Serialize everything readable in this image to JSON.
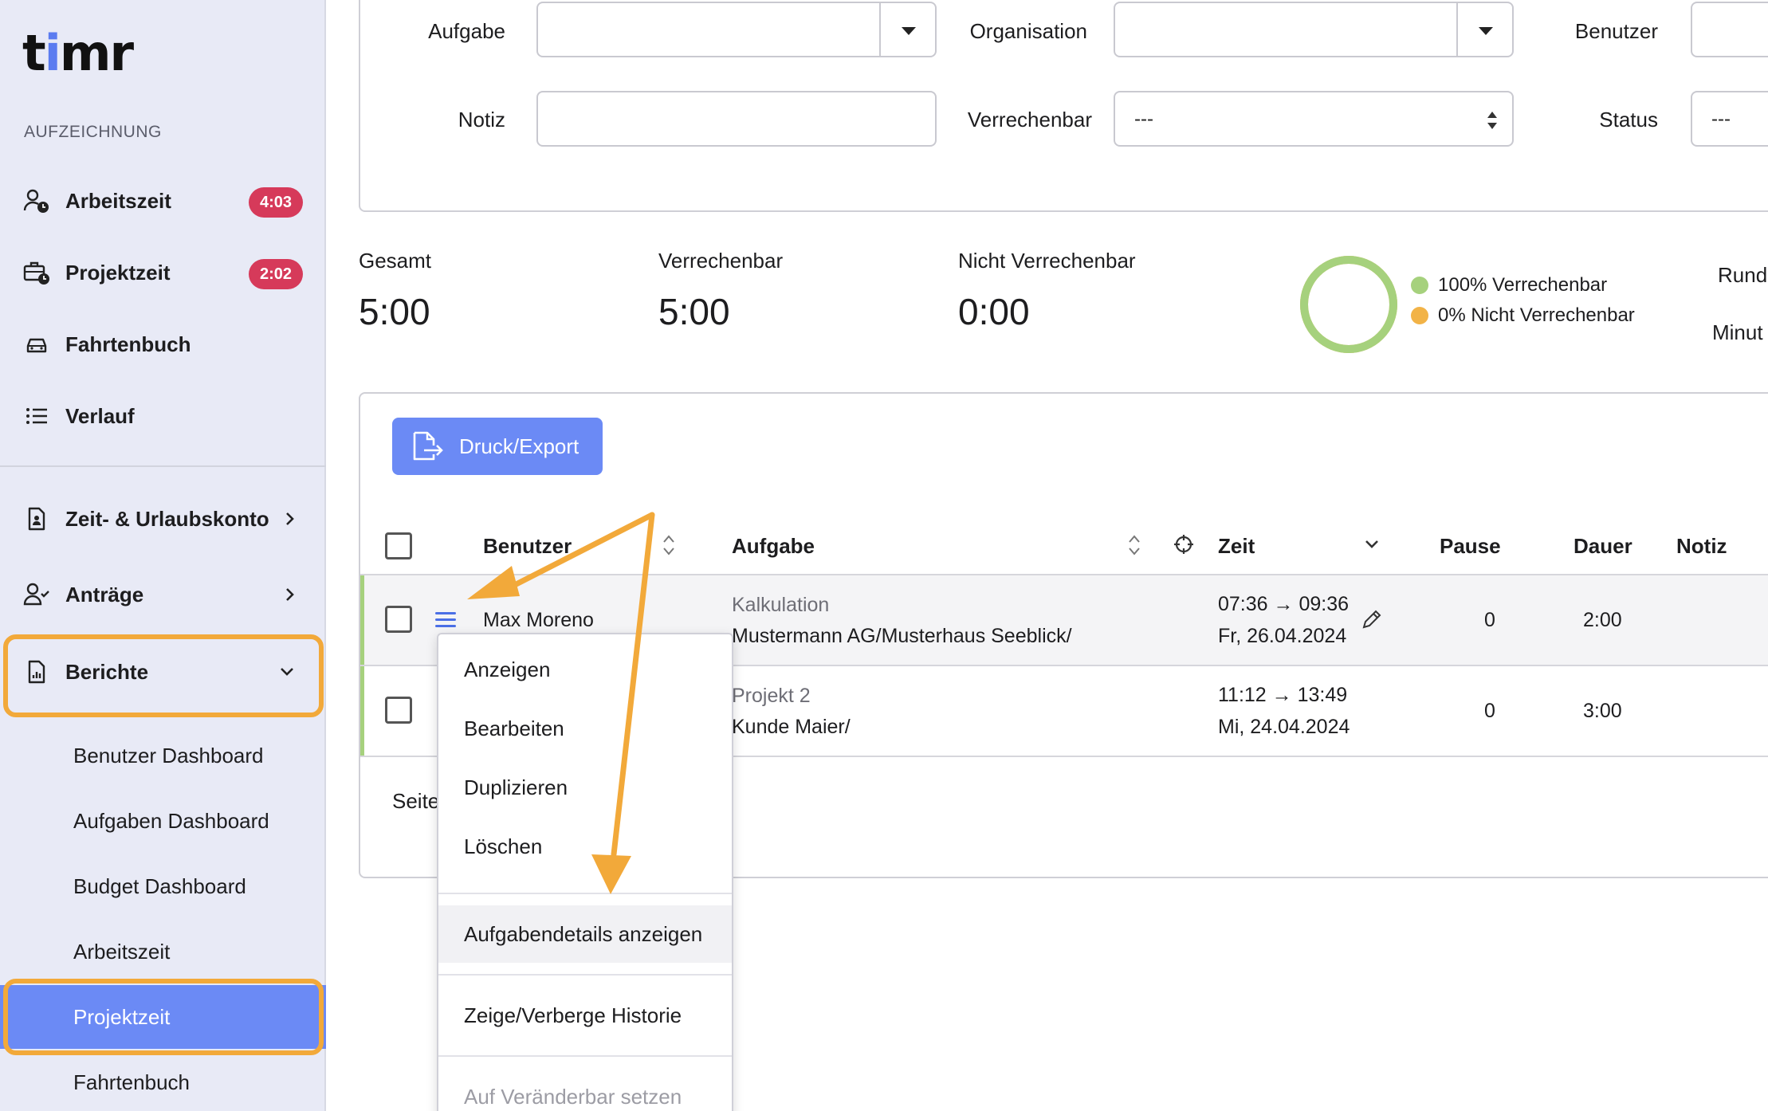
{
  "brand": {
    "logo_prefix": "t",
    "logo_i": "i",
    "logo_suffix": "mr",
    "accent": "#6b8af5",
    "highlight": "#f2a93a"
  },
  "sidebar": {
    "section_label": "AUFZEICHNUNG",
    "items": [
      {
        "label": "Arbeitszeit",
        "badge": "4:03",
        "icon": "user-clock-icon"
      },
      {
        "label": "Projektzeit",
        "badge": "2:02",
        "icon": "briefcase-clock-icon"
      },
      {
        "label": "Fahrtenbuch",
        "icon": "car-icon"
      },
      {
        "label": "Verlauf",
        "icon": "list-icon"
      }
    ],
    "group_items": [
      {
        "label": "Zeit- & Urlaubskonto",
        "icon": "document-user-icon"
      },
      {
        "label": "Anträge",
        "icon": "user-check-icon"
      },
      {
        "label": "Berichte",
        "icon": "report-icon"
      }
    ],
    "sub_items": [
      {
        "label": "Benutzer Dashboard"
      },
      {
        "label": "Aufgaben Dashboard"
      },
      {
        "label": "Budget Dashboard"
      },
      {
        "label": "Arbeitszeit"
      },
      {
        "label": "Projektzeit",
        "active": true
      },
      {
        "label": "Fahrtenbuch"
      }
    ]
  },
  "filters": {
    "aufgabe_label": "Aufgabe",
    "organisation_label": "Organisation",
    "benutzer_label": "Benutzer",
    "notiz_label": "Notiz",
    "verrechenbar_label": "Verrechenbar",
    "verrechenbar_value": "---",
    "status_label": "Status",
    "status_value": "---"
  },
  "stats": {
    "gesamt_label": "Gesamt",
    "gesamt_value": "5:00",
    "verrechenbar_label": "Verrechenbar",
    "verrechenbar_value": "5:00",
    "nicht_label": "Nicht Verrechenbar",
    "nicht_value": "0:00",
    "donut": {
      "billable_fraction": 1.0,
      "billable_color": "#a6d17d",
      "non_billable_color": "#f2b347"
    },
    "legend_billable": "100% Verrechenbar",
    "legend_non_billable": "0% Nicht Verrechenbar",
    "cut_label_1": "Rund",
    "cut_label_2": "Minut"
  },
  "table": {
    "export_label": "Druck/Export",
    "columns": {
      "benutzer": "Benutzer",
      "aufgabe": "Aufgabe",
      "zeit": "Zeit",
      "pause": "Pause",
      "dauer": "Dauer",
      "notiz": "Notiz"
    },
    "rows": [
      {
        "user": "Max Moreno",
        "task": "Kalkulation",
        "org": "Mustermann AG/Musterhaus Seeblick/",
        "time": "07:36 → 09:36",
        "date": "Fr, 26.04.2024",
        "pause": "0",
        "dauer": "2:00"
      },
      {
        "user": "",
        "task": "Projekt 2",
        "org": "Kunde Maier/",
        "time": "11:12 → 13:49",
        "date": "Mi, 24.04.2024",
        "pause": "0",
        "dauer": "3:00"
      }
    ],
    "pager_label": "Seite"
  },
  "context_menu": {
    "items": [
      {
        "label": "Anzeigen"
      },
      {
        "label": "Bearbeiten"
      },
      {
        "label": "Duplizieren"
      },
      {
        "label": "Löschen"
      },
      {
        "label": "Aufgabendetails anzeigen"
      },
      {
        "label": "Zeige/Verberge Historie"
      },
      {
        "label": "Auf Veränderbar setzen"
      }
    ]
  }
}
